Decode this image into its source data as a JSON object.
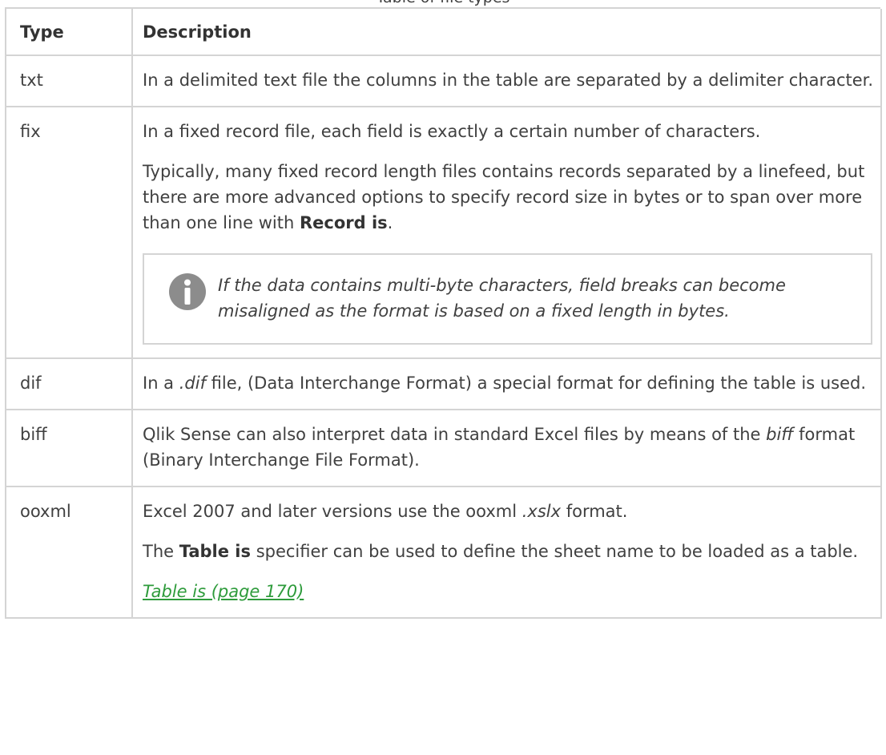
{
  "caption": "Table of file types",
  "table": {
    "headers": {
      "type": "Type",
      "description": "Description"
    },
    "rows": {
      "txt": {
        "type": "txt",
        "p1": "In a delimited text file the columns in the table are separated by a delimiter character."
      },
      "fix": {
        "type": "fix",
        "p1": "In a fixed record file, each field is exactly a certain number of characters.",
        "p2_before": "Typically, many fixed record length files contains records separated by a linefeed, but there are more advanced options to specify record size in bytes or to span over more than one line with ",
        "p2_bold": "Record is",
        "p2_after": ".",
        "note_icon": "info-circle-icon",
        "note": "If the data contains multi-byte characters, field breaks can become misaligned as the format is based on a fixed length in bytes."
      },
      "dif": {
        "type": "dif",
        "p1_before": "In a ",
        "p1_italic": ".dif",
        "p1_after": " file, (Data Interchange Format) a special format for defining the table is used."
      },
      "biff": {
        "type": "biff",
        "p1_before": "Qlik Sense can also interpret data in standard Excel files by means of the ",
        "p1_italic": "biff",
        "p1_after": " format (Binary Interchange File Format)."
      },
      "ooxml": {
        "type": "ooxml",
        "p1_before": "Excel 2007 and later versions use the ooxml ",
        "p1_italic": ".xslx",
        "p1_after": " format.",
        "p2_before": "The ",
        "p2_bold": "Table is",
        "p2_after": " specifier can be used to define the sheet name to be loaded as a table.",
        "link": "Table is (page 170)"
      }
    }
  },
  "colors": {
    "text": "#404040",
    "border": "#d4d4d4",
    "link": "#2e9b3b",
    "icon": "#8c8c8c"
  }
}
